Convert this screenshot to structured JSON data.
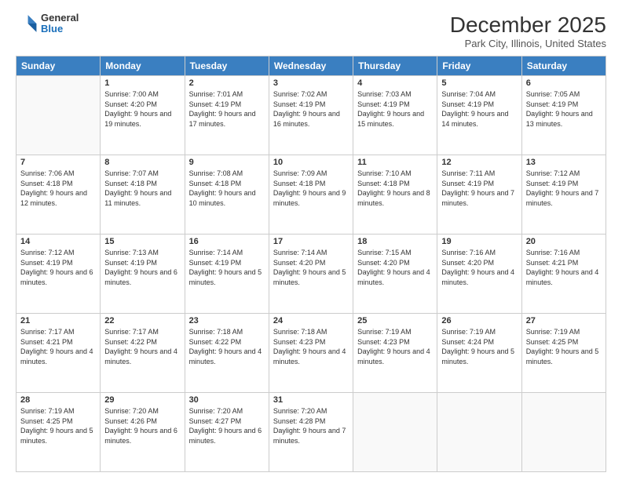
{
  "header": {
    "logo_general": "General",
    "logo_blue": "Blue",
    "month_title": "December 2025",
    "location": "Park City, Illinois, United States"
  },
  "weekdays": [
    "Sunday",
    "Monday",
    "Tuesday",
    "Wednesday",
    "Thursday",
    "Friday",
    "Saturday"
  ],
  "weeks": [
    [
      {
        "day": null,
        "info": null
      },
      {
        "day": "1",
        "sunrise": "7:00 AM",
        "sunset": "4:20 PM",
        "daylight": "9 hours and 19 minutes."
      },
      {
        "day": "2",
        "sunrise": "7:01 AM",
        "sunset": "4:19 PM",
        "daylight": "9 hours and 17 minutes."
      },
      {
        "day": "3",
        "sunrise": "7:02 AM",
        "sunset": "4:19 PM",
        "daylight": "9 hours and 16 minutes."
      },
      {
        "day": "4",
        "sunrise": "7:03 AM",
        "sunset": "4:19 PM",
        "daylight": "9 hours and 15 minutes."
      },
      {
        "day": "5",
        "sunrise": "7:04 AM",
        "sunset": "4:19 PM",
        "daylight": "9 hours and 14 minutes."
      },
      {
        "day": "6",
        "sunrise": "7:05 AM",
        "sunset": "4:19 PM",
        "daylight": "9 hours and 13 minutes."
      }
    ],
    [
      {
        "day": "7",
        "sunrise": "7:06 AM",
        "sunset": "4:18 PM",
        "daylight": "9 hours and 12 minutes."
      },
      {
        "day": "8",
        "sunrise": "7:07 AM",
        "sunset": "4:18 PM",
        "daylight": "9 hours and 11 minutes."
      },
      {
        "day": "9",
        "sunrise": "7:08 AM",
        "sunset": "4:18 PM",
        "daylight": "9 hours and 10 minutes."
      },
      {
        "day": "10",
        "sunrise": "7:09 AM",
        "sunset": "4:18 PM",
        "daylight": "9 hours and 9 minutes."
      },
      {
        "day": "11",
        "sunrise": "7:10 AM",
        "sunset": "4:18 PM",
        "daylight": "9 hours and 8 minutes."
      },
      {
        "day": "12",
        "sunrise": "7:11 AM",
        "sunset": "4:19 PM",
        "daylight": "9 hours and 7 minutes."
      },
      {
        "day": "13",
        "sunrise": "7:12 AM",
        "sunset": "4:19 PM",
        "daylight": "9 hours and 7 minutes."
      }
    ],
    [
      {
        "day": "14",
        "sunrise": "7:12 AM",
        "sunset": "4:19 PM",
        "daylight": "9 hours and 6 minutes."
      },
      {
        "day": "15",
        "sunrise": "7:13 AM",
        "sunset": "4:19 PM",
        "daylight": "9 hours and 6 minutes."
      },
      {
        "day": "16",
        "sunrise": "7:14 AM",
        "sunset": "4:19 PM",
        "daylight": "9 hours and 5 minutes."
      },
      {
        "day": "17",
        "sunrise": "7:14 AM",
        "sunset": "4:20 PM",
        "daylight": "9 hours and 5 minutes."
      },
      {
        "day": "18",
        "sunrise": "7:15 AM",
        "sunset": "4:20 PM",
        "daylight": "9 hours and 4 minutes."
      },
      {
        "day": "19",
        "sunrise": "7:16 AM",
        "sunset": "4:20 PM",
        "daylight": "9 hours and 4 minutes."
      },
      {
        "day": "20",
        "sunrise": "7:16 AM",
        "sunset": "4:21 PM",
        "daylight": "9 hours and 4 minutes."
      }
    ],
    [
      {
        "day": "21",
        "sunrise": "7:17 AM",
        "sunset": "4:21 PM",
        "daylight": "9 hours and 4 minutes."
      },
      {
        "day": "22",
        "sunrise": "7:17 AM",
        "sunset": "4:22 PM",
        "daylight": "9 hours and 4 minutes."
      },
      {
        "day": "23",
        "sunrise": "7:18 AM",
        "sunset": "4:22 PM",
        "daylight": "9 hours and 4 minutes."
      },
      {
        "day": "24",
        "sunrise": "7:18 AM",
        "sunset": "4:23 PM",
        "daylight": "9 hours and 4 minutes."
      },
      {
        "day": "25",
        "sunrise": "7:19 AM",
        "sunset": "4:23 PM",
        "daylight": "9 hours and 4 minutes."
      },
      {
        "day": "26",
        "sunrise": "7:19 AM",
        "sunset": "4:24 PM",
        "daylight": "9 hours and 5 minutes."
      },
      {
        "day": "27",
        "sunrise": "7:19 AM",
        "sunset": "4:25 PM",
        "daylight": "9 hours and 5 minutes."
      }
    ],
    [
      {
        "day": "28",
        "sunrise": "7:19 AM",
        "sunset": "4:25 PM",
        "daylight": "9 hours and 5 minutes."
      },
      {
        "day": "29",
        "sunrise": "7:20 AM",
        "sunset": "4:26 PM",
        "daylight": "9 hours and 6 minutes."
      },
      {
        "day": "30",
        "sunrise": "7:20 AM",
        "sunset": "4:27 PM",
        "daylight": "9 hours and 6 minutes."
      },
      {
        "day": "31",
        "sunrise": "7:20 AM",
        "sunset": "4:28 PM",
        "daylight": "9 hours and 7 minutes."
      },
      {
        "day": null,
        "info": null
      },
      {
        "day": null,
        "info": null
      },
      {
        "day": null,
        "info": null
      }
    ]
  ]
}
